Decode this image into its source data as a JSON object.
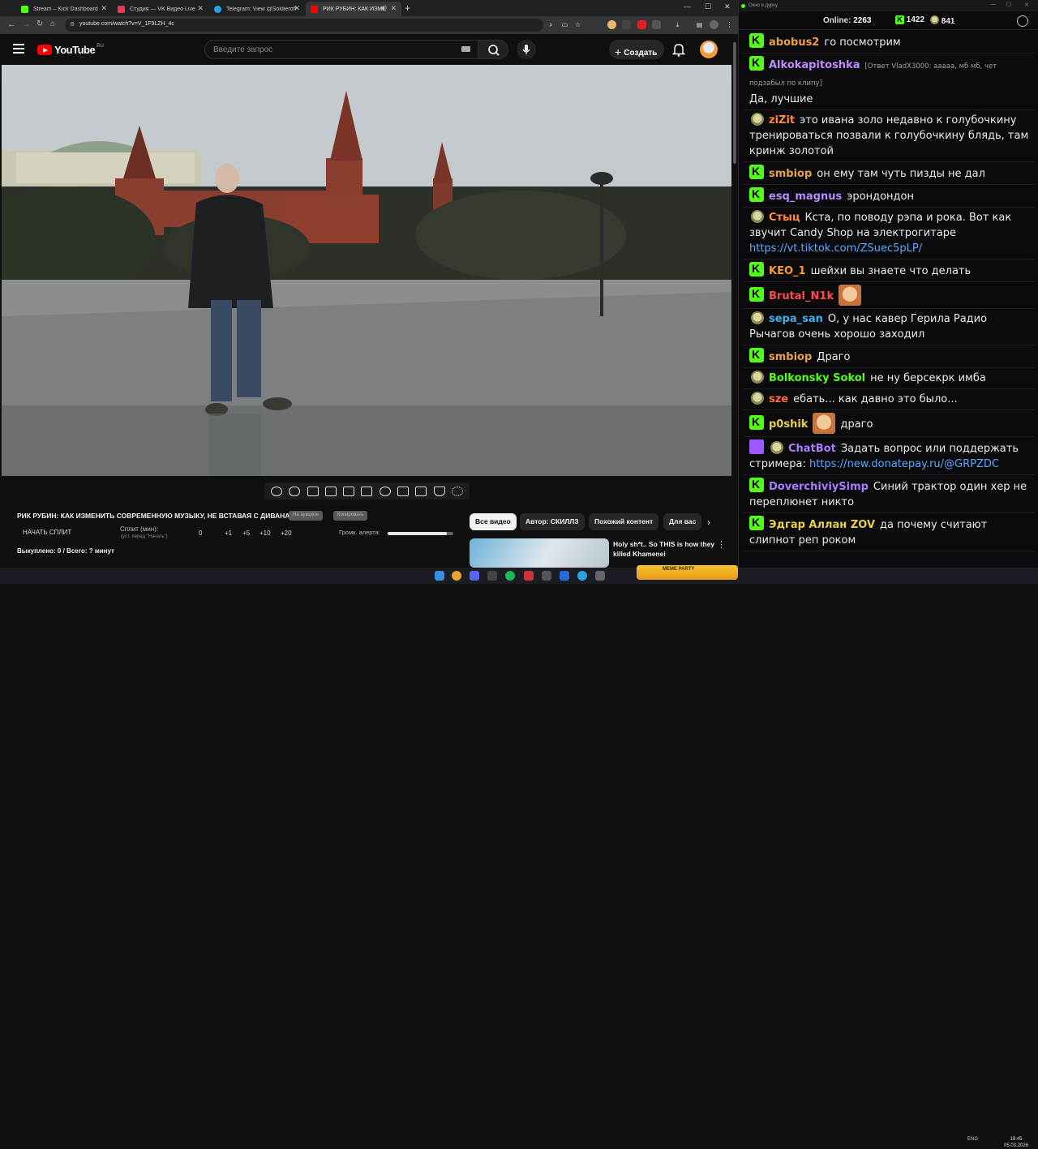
{
  "browser": {
    "tabs": [
      {
        "label": "Stream – Kick Dashboard",
        "color": "#53fc18"
      },
      {
        "label": "Студия — VK Видео Live",
        "color": "#e63b5a"
      },
      {
        "label": "Telegram: View @Soldierofforte",
        "color": "#2aa3e0"
      },
      {
        "label": "РИК РУБИН: КАК ИЗМЕНИТЬ",
        "color": "#ff0000",
        "active": true
      }
    ],
    "url": "youtube.com/watch?v=V_1F9LZH_4c"
  },
  "youtube": {
    "logo_text": "YouTube",
    "logo_region": "RU",
    "search_placeholder": "Введите запрос",
    "create_label": "Создать"
  },
  "video_title": "РИК РУБИН: КАК ИЗМЕНИТЬ СОВРЕМЕННУЮ МУЗЫКУ, НЕ ВСТАВАЯ С ДИВАНА",
  "pills": [
    "На аукцион",
    "Копировать"
  ],
  "split": {
    "start_label": "НАЧАТЬ СПЛИТ",
    "minutes_label": "Сплит (мин):",
    "minutes_sub": "(уст. перед \"Начать\")",
    "value": "0",
    "increments": [
      "+1",
      "+5",
      "+10",
      "+20"
    ],
    "alert_volume_label": "Громк. алерта:",
    "alert_volume": 0.9,
    "bought_label": "Выкуплено: 0 / Всего: ? минут"
  },
  "chips": [
    {
      "label": "Все видео",
      "selected": true
    },
    {
      "label": "Автор: СКИЛЛЗ",
      "selected": false
    },
    {
      "label": "Похожий контент",
      "selected": false
    },
    {
      "label": "Для вас",
      "selected": false
    }
  ],
  "recommendation": {
    "title": "Holy sh*t.. So THIS is how they killed Khamenei"
  },
  "chat": {
    "window_title": "Окно в дурку",
    "online_label": "Online:",
    "online_count": "2263",
    "kick_count": "1422",
    "skull_count": "841",
    "accent": "#53fc18",
    "messages": [
      {
        "badge": "k",
        "user": "abobus2",
        "color": "#e6a14a",
        "text": "го посмотрим"
      },
      {
        "badge": "k",
        "user": "Alkokapitoshka",
        "color": "#c18cff",
        "reply": "[Ответ VladX3000: ааааа, мб мб, чет подзабыл по клипу]",
        "text": "Да, лучшие"
      },
      {
        "badge": "skull",
        "user": "ziZit",
        "color": "#ff8a3d",
        "text": "это ивана золо недавно к голубочкину тренироваться позвали к голубочкину блядь, там кринж золотой"
      },
      {
        "badge": "k",
        "user": "smbiop",
        "color": "#e6a14a",
        "text": "он ему там чуть пизды не дал"
      },
      {
        "badge": "k",
        "user": "esq_magnus",
        "color": "#b989ff",
        "text": "эрондондон"
      },
      {
        "badge": "skull",
        "user": "Стыц",
        "color": "#ff8a3d",
        "text": "Кста, по поводу рэпа и рока. Вот как звучит Candy Shop на электрогитаре",
        "link": "https://vt.tiktok.com/ZSuec5pLP/"
      },
      {
        "badge": "k",
        "user": "KEO_1",
        "color": "#ff9a2e",
        "text": "шейхи вы знаете что делать"
      },
      {
        "badge": "k",
        "user": "Brutal_N1k",
        "color": "#ff4a4a",
        "text": "",
        "emote": true
      },
      {
        "badge": "skull",
        "user": "sepa_san",
        "color": "#3fb0e8",
        "text": "О, у нас кавер Герила Радио Рычагов очень хорошо заходил"
      },
      {
        "badge": "k",
        "user": "smbiop",
        "color": "#e6a14a",
        "text": "Драго"
      },
      {
        "badge": "skull",
        "user": "Bolkonsky Sokol",
        "color": "#53fc18",
        "text": "не ну берсекрк имба"
      },
      {
        "badge": "skull",
        "user": "sze",
        "color": "#ff6a4a",
        "text": "ебать... как давно это было..."
      },
      {
        "badge": "k",
        "user": "p0shik",
        "color": "#e6d04a",
        "text": "драго",
        "emote_before": true
      },
      {
        "badge": "bot",
        "user": "ChatBot",
        "color": "#a97cff",
        "text": "Задать вопрос или поддержать стримера:",
        "link": "https://new.donatepay.ru/@GRPZDC"
      },
      {
        "badge": "k",
        "user": "DoverchiviySimp",
        "color": "#a97cff",
        "text": "Синий трактор один хер не переплюнет никто"
      },
      {
        "badge": "k",
        "user": "Эдгар Аллан ZOV",
        "color": "#e6d04a",
        "text": "да почему считают слипнот реп роком"
      }
    ]
  },
  "taskbar": {
    "widget_text": "MEME PARTY",
    "lang": "ENG",
    "time": "18:45",
    "date": "05.03.2026"
  }
}
